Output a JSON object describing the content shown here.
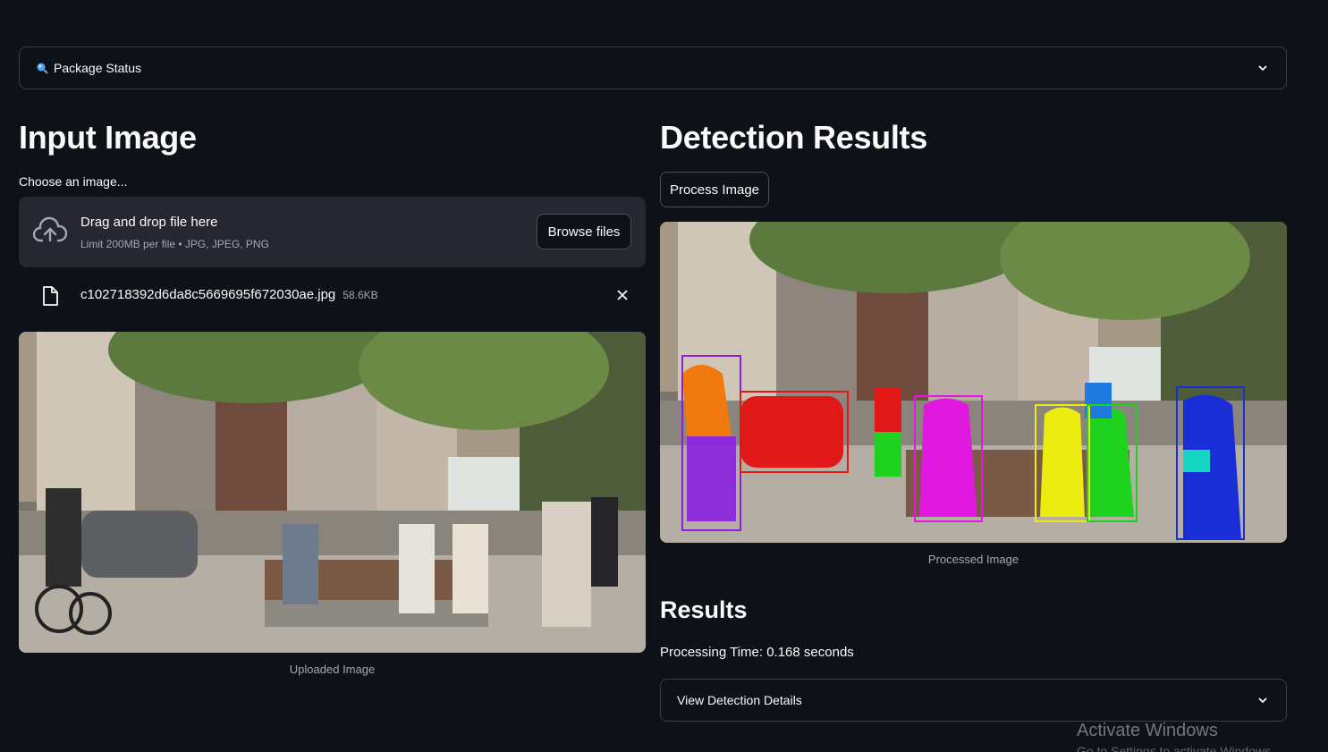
{
  "package_status": {
    "label": "Package Status",
    "icon": "magnifier-icon"
  },
  "left": {
    "heading": "Input Image",
    "uploader_label": "Choose an image...",
    "dropzone": {
      "title": "Drag and drop file here",
      "limit": "Limit 200MB per file • JPG, JPEG, PNG",
      "browse_label": "Browse files"
    },
    "file": {
      "name": "c102718392d6da8c5669695f672030ae.jpg",
      "size": "58.6KB"
    },
    "image_caption": "Uploaded Image"
  },
  "right": {
    "heading": "Detection Results",
    "process_label": "Process Image",
    "image_caption": "Processed Image",
    "results_heading": "Results",
    "processing_time": "Processing Time: 0.168 seconds",
    "details_label": "View Detection Details"
  },
  "watermark": {
    "line1": "Activate Windows",
    "line2": "Go to Settings to activate Windows."
  },
  "colors": {
    "background": "#0e1117",
    "surface": "#262730",
    "border": "#3a3d47"
  }
}
